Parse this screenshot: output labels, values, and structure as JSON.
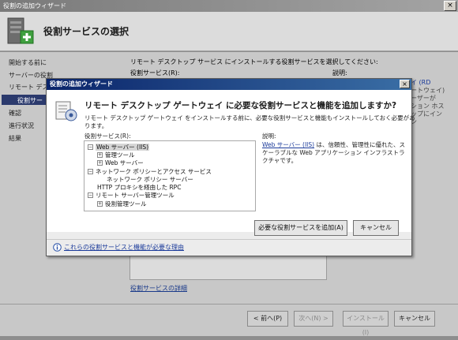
{
  "outer": {
    "title": "役割の追加ウィザード",
    "close_glyph": "×",
    "header_title": "役割サービスの選択",
    "nav": [
      "開始する前に",
      "サーバーの役割",
      "リモート デスクト",
      "役割サー",
      "確認",
      "進行状況",
      "結果"
    ],
    "content_intro": "リモート デスクトップ サービス にインストールする役割サービスを選択してください:",
    "content_roles_label": "役割サービス(R):",
    "content_desc_label": "説明:",
    "right_fragment": [
      "イ (RD",
      "ートウェイ)",
      "ーザーが",
      "ション ホス",
      "ップにイン",
      "ン"
    ],
    "detail_link": "役割サービスの詳細",
    "buttons": {
      "back": "< 前へ(P)",
      "next": "次へ(N) >",
      "install": "インストール(I)",
      "cancel": "キャンセル"
    }
  },
  "dialog": {
    "title": "役割の追加ウィザード",
    "close_glyph": "×",
    "heading": "リモート デスクトップ ゲートウェイ に必要な役割サービスと機能を追加しますか?",
    "description": "リモート デスクトップ ゲートウェイ をインストールする前に、必要な役割サービスと機能もインストールしておく必要があります。",
    "roles_label": "役割サービス(R):",
    "tree": [
      {
        "toggle": "−",
        "label": "Web サーバー (IIS)",
        "indent": 0,
        "highlight": true
      },
      {
        "toggle": "+",
        "label": "管理ツール",
        "indent": 1
      },
      {
        "toggle": "+",
        "label": "Web サーバー",
        "indent": 1
      },
      {
        "toggle": "−",
        "label": "ネットワーク ポリシーとアクセス サービス",
        "indent": 0
      },
      {
        "toggle": "",
        "label": "ネットワーク ポリシー サーバー",
        "indent": 2
      },
      {
        "toggle": "",
        "label": "HTTP プロキシを経由した RPC",
        "indent": 0
      },
      {
        "toggle": "−",
        "label": "リモート サーバー管理ツール",
        "indent": 0
      },
      {
        "toggle": "+",
        "label": "役割管理ツール",
        "indent": 1
      }
    ],
    "desc_label": "説明:",
    "desc_link": "Web サーバー (IIS)",
    "desc_rest": " は、信頼性、管理性に優れた、スケーラブルな Web アプリケーション インフラストラクチャです。",
    "buttons": {
      "add": "必要な役割サービスを追加(A)",
      "cancel": "キャンセル"
    },
    "info_link": "これらの役割サービスと機能が必要な理由"
  }
}
